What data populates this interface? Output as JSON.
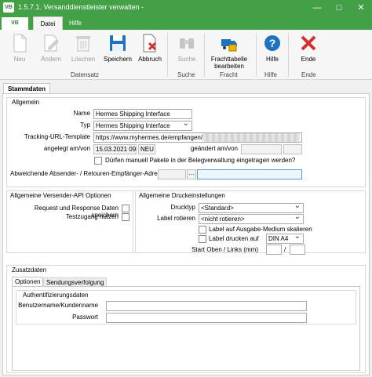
{
  "window": {
    "app_icon": "VB",
    "title": "1.5.7.1. Versanddienstleister verwalten -"
  },
  "tabs": {
    "file": "VB",
    "datei": "Datei",
    "hilfe": "Hilfe"
  },
  "ribbon": {
    "neu": "Neu",
    "aendern": "Ändern",
    "loeschen": "Löschen",
    "speichern": "Speichern",
    "abbruch": "Abbruch",
    "suche": "Suche",
    "frachttabelle_1": "Frachttabelle",
    "frachttabelle_2": "bearbeiten",
    "hilfe": "Hilfe",
    "ende": "Ende",
    "groups": {
      "datensatz": "Datensatz",
      "suche": "Suche",
      "fracht": "Fracht",
      "hilfe": "Hilfe",
      "ende": "Ende"
    }
  },
  "page_tab": "Stammdaten",
  "allgemein": {
    "title": "Allgemein",
    "name_label": "Name",
    "name_value": "Hermes Shipping Interface",
    "typ_label": "Typ",
    "typ_value": "Hermes Shipping Interface",
    "tracking_label": "Tracking-URL-Template",
    "tracking_value": "https://www.myhermes.de/empfangen/",
    "angelegt_label": "angelegt am/von",
    "angelegt_date": "15.03.2021 09:",
    "angelegt_user": "NEU",
    "geaendert_label": "geändert am/von",
    "manual_label": "Dürfen manuell Pakete in der Belegverwaltung eingetragen werden?",
    "absender_label": "Abweichende Absender- / Retouren-Empfänger-Adresse",
    "browse": "···"
  },
  "versender_api": {
    "title": "Allgemeine Versender-API Optionen",
    "request_label": "Request und Response Daten speichern",
    "test_label": "Testzugang nutzen"
  },
  "druck": {
    "title": "Allgemeine Druckeinstellungen",
    "drucktyp_label": "Drucktyp",
    "drucktyp_value": "<Standard>",
    "rotieren_label": "Label rotieren",
    "rotieren_value": "<nicht rotieren>",
    "skalieren_label": "Label auf Ausgabe-Medium skalieren",
    "drucken_auf_label": "Label drucken auf",
    "drucken_auf_value": "DIN A4",
    "start_label": "Start Oben / Links (mm)",
    "slash": "/"
  },
  "zusatz": {
    "title": "Zusatzdaten",
    "tab_optionen": "Optionen",
    "tab_verfolgung": "Sendungsverfolgung",
    "auth_title": "Authentifizierungsdaten",
    "benutzer_label": "Benutzername/Kundenname",
    "passwort_label": "Passwort"
  },
  "colors": {
    "title_bar": "#43a047",
    "accent_blue": "#1e73be",
    "cancel_red": "#d32f2f"
  }
}
